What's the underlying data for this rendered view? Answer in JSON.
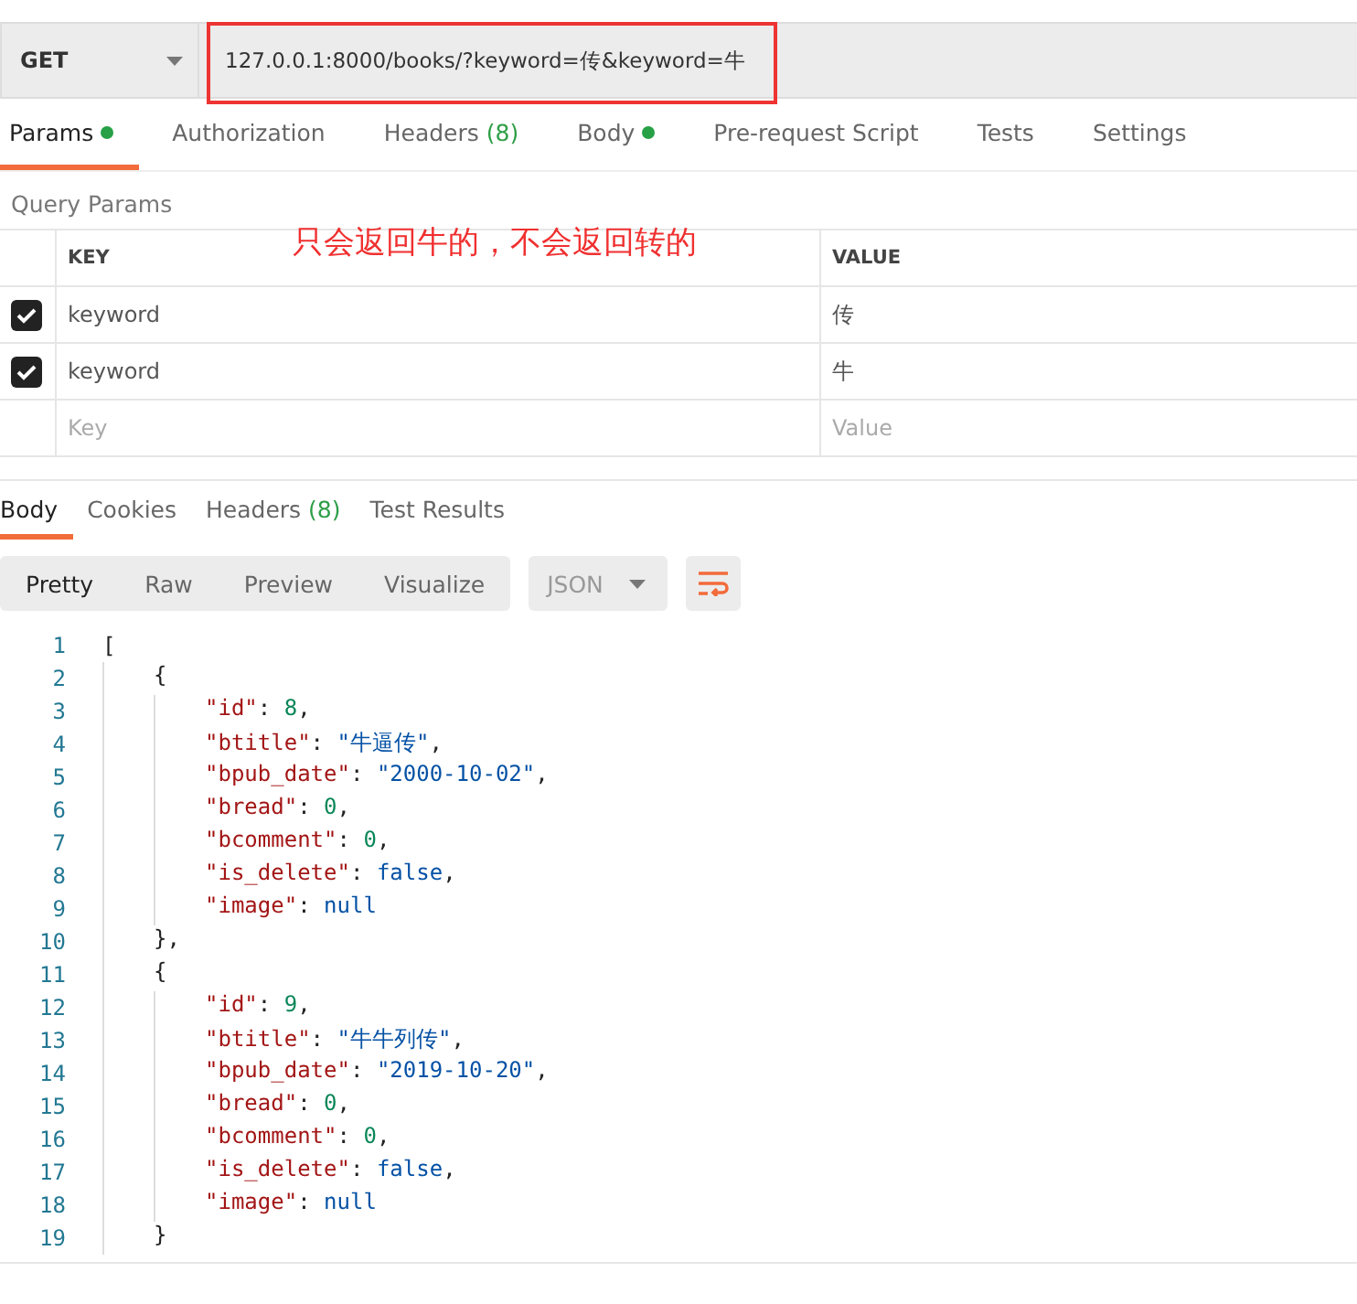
{
  "request": {
    "method": "GET",
    "url": "127.0.0.1:8000/books/?keyword=传&keyword=牛",
    "highlighted": true
  },
  "request_tabs": [
    {
      "label": "Params",
      "dot": true,
      "selected": true
    },
    {
      "label": "Authorization",
      "dot": false,
      "selected": false
    },
    {
      "label": "Headers",
      "count": "(8)",
      "dot": false,
      "selected": false
    },
    {
      "label": "Body",
      "dot": true,
      "selected": false
    },
    {
      "label": "Pre-request Script",
      "dot": false,
      "selected": false
    },
    {
      "label": "Tests",
      "dot": false,
      "selected": false
    },
    {
      "label": "Settings",
      "dot": false,
      "selected": false
    }
  ],
  "query_params": {
    "title": "Query Params",
    "columns": [
      "KEY",
      "VALUE"
    ],
    "rows": [
      {
        "key": "keyword",
        "value": "传",
        "checked": true
      },
      {
        "key": "keyword",
        "value": "牛",
        "checked": true
      }
    ],
    "new_row": {
      "key_placeholder": "Key",
      "value_placeholder": "Value"
    },
    "annotation": "只会返回牛的，不会返回转的"
  },
  "response_tabs": [
    {
      "label": "Body",
      "selected": true
    },
    {
      "label": "Cookies",
      "selected": false
    },
    {
      "label": "Headers",
      "count": "(8)",
      "selected": false
    },
    {
      "label": "Test Results",
      "selected": false
    }
  ],
  "view_modes": [
    {
      "label": "Pretty",
      "selected": true
    },
    {
      "label": "Raw",
      "selected": false
    },
    {
      "label": "Preview",
      "selected": false
    },
    {
      "label": "Visualize",
      "selected": false
    }
  ],
  "format": "JSON",
  "code": [
    {
      "n": "1",
      "tokens": [
        {
          "kind": "punct",
          "text": "["
        }
      ]
    },
    {
      "n": "2",
      "tokens": [
        {
          "kind": "punct",
          "text": "{"
        }
      ]
    },
    {
      "n": "3",
      "tokens": [
        {
          "kind": "key",
          "text": "\"id\""
        },
        {
          "kind": "punct",
          "text": ": "
        },
        {
          "kind": "number",
          "text": "8"
        },
        {
          "kind": "punct",
          "text": ","
        }
      ]
    },
    {
      "n": "4",
      "tokens": [
        {
          "kind": "key",
          "text": "\"btitle\""
        },
        {
          "kind": "punct",
          "text": ": "
        },
        {
          "kind": "string",
          "text": "\"牛逼传\""
        },
        {
          "kind": "punct",
          "text": ","
        }
      ]
    },
    {
      "n": "5",
      "tokens": [
        {
          "kind": "key",
          "text": "\"bpub_date\""
        },
        {
          "kind": "punct",
          "text": ": "
        },
        {
          "kind": "string",
          "text": "\"2000-10-02\""
        },
        {
          "kind": "punct",
          "text": ","
        }
      ]
    },
    {
      "n": "6",
      "tokens": [
        {
          "kind": "key",
          "text": "\"bread\""
        },
        {
          "kind": "punct",
          "text": ": "
        },
        {
          "kind": "number",
          "text": "0"
        },
        {
          "kind": "punct",
          "text": ","
        }
      ]
    },
    {
      "n": "7",
      "tokens": [
        {
          "kind": "key",
          "text": "\"bcomment\""
        },
        {
          "kind": "punct",
          "text": ": "
        },
        {
          "kind": "number",
          "text": "0"
        },
        {
          "kind": "punct",
          "text": ","
        }
      ]
    },
    {
      "n": "8",
      "tokens": [
        {
          "kind": "key",
          "text": "\"is_delete\""
        },
        {
          "kind": "punct",
          "text": ": "
        },
        {
          "kind": "literal",
          "text": "false"
        },
        {
          "kind": "punct",
          "text": ","
        }
      ]
    },
    {
      "n": "9",
      "tokens": [
        {
          "kind": "key",
          "text": "\"image\""
        },
        {
          "kind": "punct",
          "text": ": "
        },
        {
          "kind": "literal",
          "text": "null"
        }
      ]
    },
    {
      "n": "10",
      "tokens": [
        {
          "kind": "punct",
          "text": "},"
        }
      ]
    },
    {
      "n": "11",
      "tokens": [
        {
          "kind": "punct",
          "text": "{"
        }
      ]
    },
    {
      "n": "12",
      "tokens": [
        {
          "kind": "key",
          "text": "\"id\""
        },
        {
          "kind": "punct",
          "text": ": "
        },
        {
          "kind": "number",
          "text": "9"
        },
        {
          "kind": "punct",
          "text": ","
        }
      ]
    },
    {
      "n": "13",
      "tokens": [
        {
          "kind": "key",
          "text": "\"btitle\""
        },
        {
          "kind": "punct",
          "text": ": "
        },
        {
          "kind": "string",
          "text": "\"牛牛列传\""
        },
        {
          "kind": "punct",
          "text": ","
        }
      ]
    },
    {
      "n": "14",
      "tokens": [
        {
          "kind": "key",
          "text": "\"bpub_date\""
        },
        {
          "kind": "punct",
          "text": ": "
        },
        {
          "kind": "string",
          "text": "\"2019-10-20\""
        },
        {
          "kind": "punct",
          "text": ","
        }
      ]
    },
    {
      "n": "15",
      "tokens": [
        {
          "kind": "key",
          "text": "\"bread\""
        },
        {
          "kind": "punct",
          "text": ": "
        },
        {
          "kind": "number",
          "text": "0"
        },
        {
          "kind": "punct",
          "text": ","
        }
      ]
    },
    {
      "n": "16",
      "tokens": [
        {
          "kind": "key",
          "text": "\"bcomment\""
        },
        {
          "kind": "punct",
          "text": ": "
        },
        {
          "kind": "number",
          "text": "0"
        },
        {
          "kind": "punct",
          "text": ","
        }
      ]
    },
    {
      "n": "17",
      "tokens": [
        {
          "kind": "key",
          "text": "\"is_delete\""
        },
        {
          "kind": "punct",
          "text": ": "
        },
        {
          "kind": "literal",
          "text": "false"
        },
        {
          "kind": "punct",
          "text": ","
        }
      ]
    },
    {
      "n": "18",
      "tokens": [
        {
          "kind": "key",
          "text": "\"image\""
        },
        {
          "kind": "punct",
          "text": ": "
        },
        {
          "kind": "literal",
          "text": "null"
        }
      ]
    },
    {
      "n": "19",
      "tokens": [
        {
          "kind": "punct",
          "text": "}"
        }
      ]
    }
  ]
}
